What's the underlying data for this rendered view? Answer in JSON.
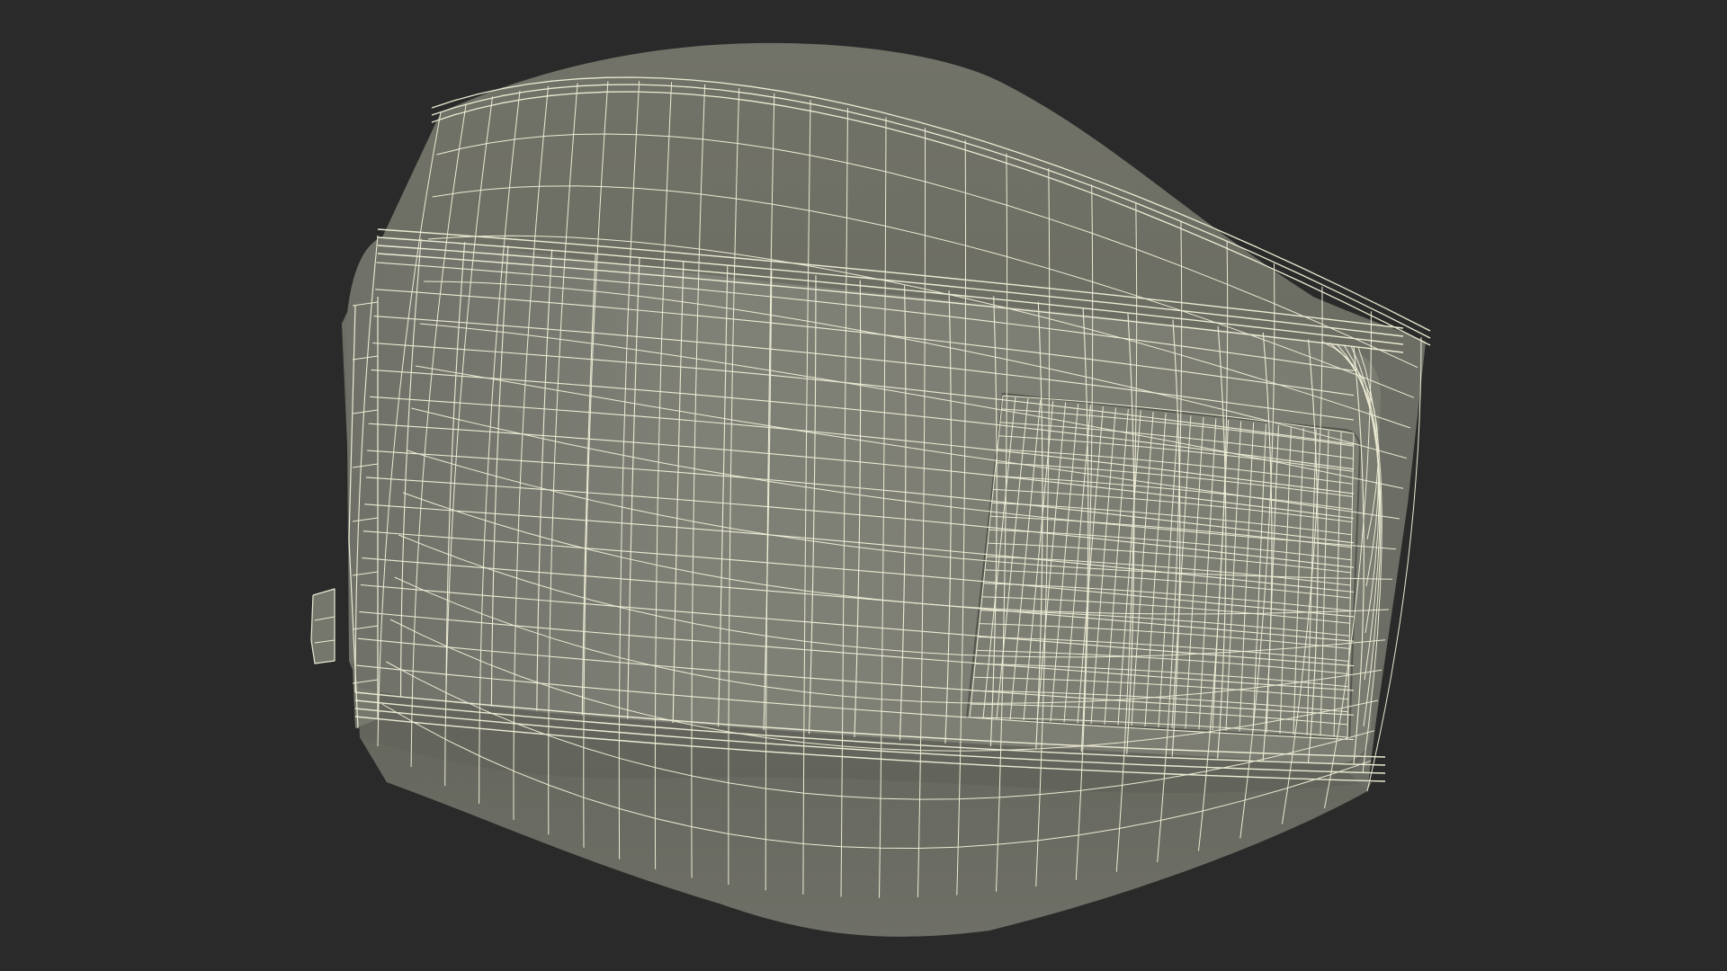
{
  "scene": {
    "subject": "wireframe-3d-model",
    "background_color": "#2a2a2a",
    "surface_color": "#7b7c72",
    "surface_shadow_color": "#64655c",
    "wire_color": "#ecebd4"
  }
}
